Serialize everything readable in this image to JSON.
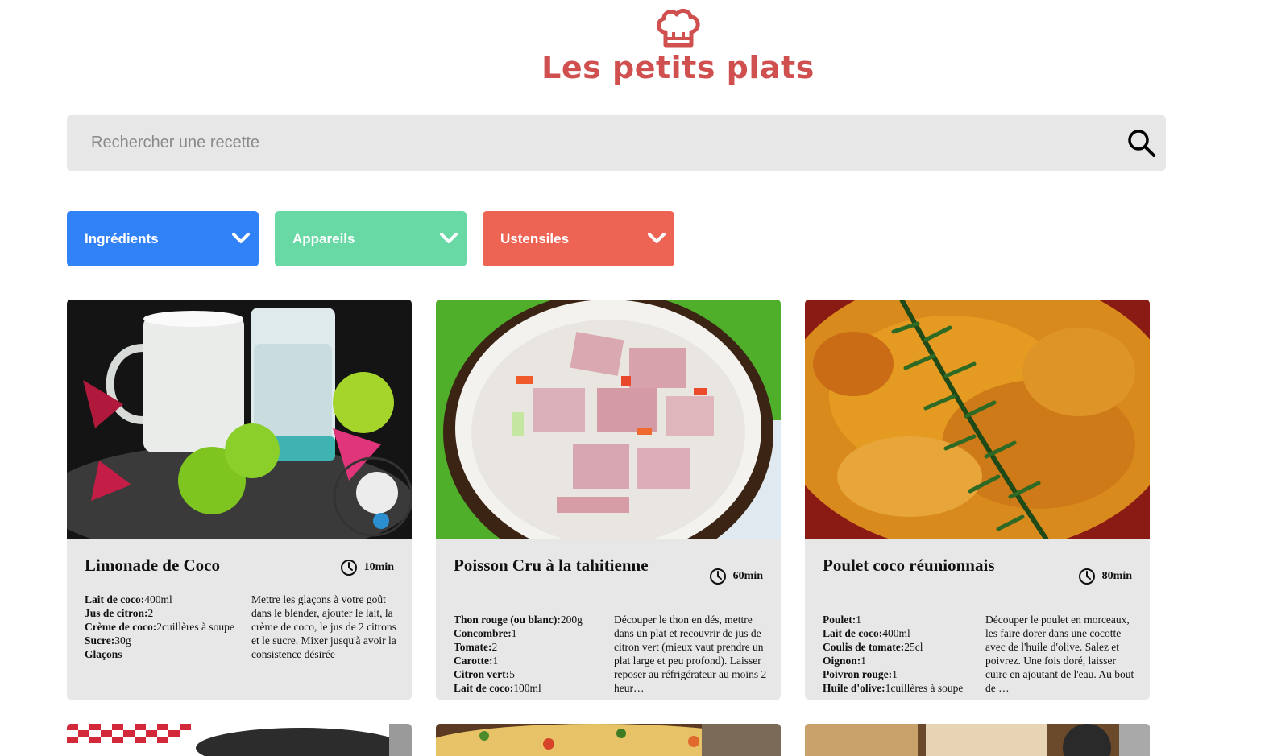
{
  "brand": {
    "title": "Les petits plats",
    "logo_icon": "chef-hat-icon",
    "color": "#d04f4f"
  },
  "search": {
    "placeholder": "Rechercher une recette",
    "value": "",
    "icon": "search-icon"
  },
  "filters": [
    {
      "label": "Ingrédients",
      "color": "#3282f7"
    },
    {
      "label": "Appareils",
      "color": "#68d9a4"
    },
    {
      "label": "Ustensiles",
      "color": "#ed6454"
    }
  ],
  "recipes": [
    {
      "name": "Limonade de Coco",
      "time": "10min",
      "ingredients": [
        {
          "name": "Lait de coco:",
          "qty": "400ml"
        },
        {
          "name": "Jus de citron:",
          "qty": "2"
        },
        {
          "name": "Crème de coco:",
          "qty": "2cuillères à soupe"
        },
        {
          "name": "Sucre:",
          "qty": "30g"
        },
        {
          "name": "Glaçons",
          "qty": ""
        }
      ],
      "description": "Mettre les glaçons à votre goût dans le blender, ajouter le lait, la crème de coco, le jus de 2 citrons et le sucre. Mixer jusqu'à avoir la consistence désirée"
    },
    {
      "name": "Poisson Cru à la tahitienne",
      "time": "60min",
      "ingredients": [
        {
          "name": "Thon rouge (ou blanc):",
          "qty": "200g"
        },
        {
          "name": "Concombre:",
          "qty": "1"
        },
        {
          "name": "Tomate:",
          "qty": "2"
        },
        {
          "name": "Carotte:",
          "qty": "1"
        },
        {
          "name": "Citron vert:",
          "qty": "5"
        },
        {
          "name": "Lait de coco:",
          "qty": "100ml"
        }
      ],
      "description": "Découper le thon en dés, mettre dans un plat et recouvrir de jus de citron vert (mieux vaut prendre un plat large et peu profond). Laisser reposer au réfrigérateur au moins 2 heur…"
    },
    {
      "name": "Poulet coco réunionnais",
      "time": "80min",
      "ingredients": [
        {
          "name": "Poulet:",
          "qty": "1"
        },
        {
          "name": "Lait de coco:",
          "qty": "400ml"
        },
        {
          "name": "Coulis de tomate:",
          "qty": "25cl"
        },
        {
          "name": "Oignon:",
          "qty": "1"
        },
        {
          "name": "Poivron rouge:",
          "qty": "1"
        },
        {
          "name": "Huile d'olive:",
          "qty": "1cuillères à soupe"
        }
      ],
      "description": "Découper le poulet en morceaux, les faire dorer dans une cocotte avec de l'huile d'olive. Salez et poivrez. Une fois doré, laisser cuire en ajoutant de l'eau. Au bout de …"
    }
  ]
}
